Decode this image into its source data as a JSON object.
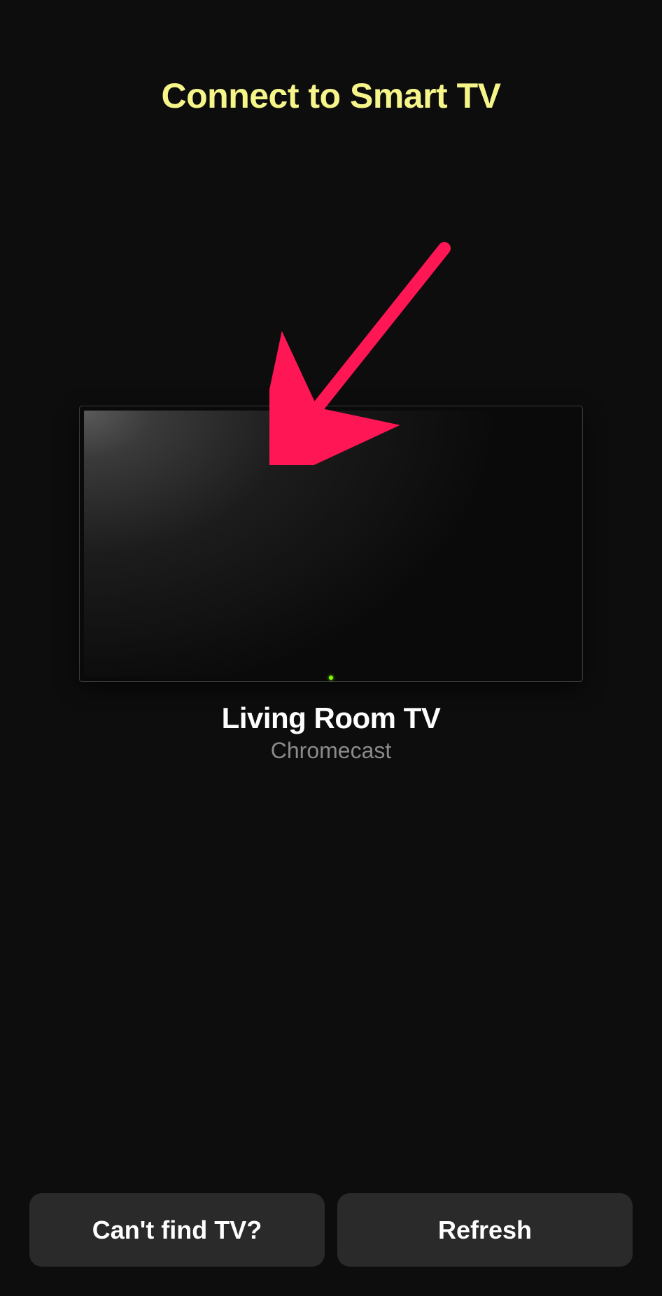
{
  "header": {
    "title": "Connect to Smart TV"
  },
  "device": {
    "name": "Living Room TV",
    "type": "Chromecast"
  },
  "buttons": {
    "help_label": "Can't find TV?",
    "refresh_label": "Refresh"
  },
  "annotation": {
    "color": "#ff1654"
  }
}
